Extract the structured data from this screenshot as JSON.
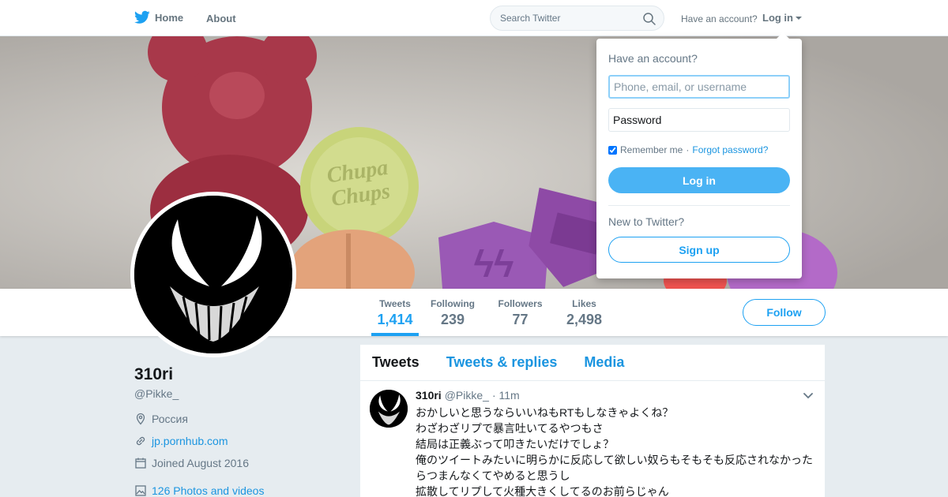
{
  "nav": {
    "home_label": "Home",
    "about_label": "About",
    "search_placeholder": "Search Twitter",
    "have_account": "Have an account?",
    "login_label": "Log in"
  },
  "colors": {
    "accent": "#1da1f2",
    "link": "#1b95e0",
    "login_button": "#4ab3f4",
    "page_bg": "#e6ecf0"
  },
  "stats": [
    {
      "label": "Tweets",
      "value": "1,414"
    },
    {
      "label": "Following",
      "value": "239"
    },
    {
      "label": "Followers",
      "value": "77"
    },
    {
      "label": "Likes",
      "value": "2,498"
    }
  ],
  "follow_label": "Follow",
  "profile": {
    "name": "310ri",
    "handle": "@Pikke_",
    "location": "Россия",
    "website": "jp.pornhub.com",
    "joined": "Joined August 2016",
    "media": "126 Photos and videos"
  },
  "tabs": [
    "Tweets",
    "Tweets & replies",
    "Media"
  ],
  "tweet": {
    "name": "310ri",
    "handle": "@Pikke_",
    "time": "· 11m",
    "lines": [
      "おかしいと思うならいいねもRTもしなきゃよくね？",
      "わざわざリプで暴言吐いてるやつもさ",
      "結局は正義ぶって叩きたいだけでしょ？",
      "俺のツイートみたいに明らかに反応して欲しい奴らもそもそも反応されなかった",
      "らつまんなくてやめると思うし",
      "拡散してリプして火種大きくしてるのお前らじゃん"
    ]
  },
  "login": {
    "title": "Have an account?",
    "username_placeholder": "Phone, email, or username",
    "password_placeholder": "Password",
    "remember_label": "Remember me",
    "separator": "·",
    "forgot_label": "Forgot password?",
    "login_button": "Log in",
    "new_label": "New to Twitter?",
    "signup_button": "Sign up"
  }
}
